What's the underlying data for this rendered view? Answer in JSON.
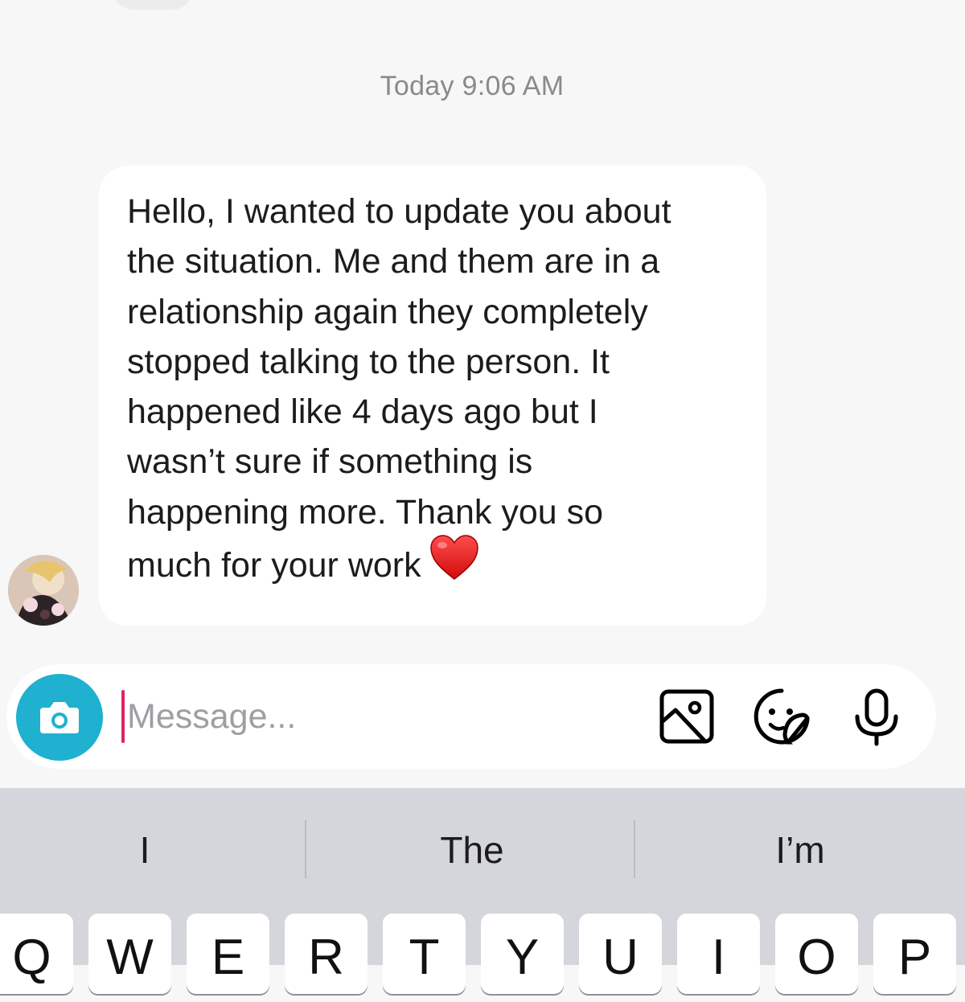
{
  "conversation": {
    "timestamp": "Today 9:06 AM",
    "message": {
      "lines": [
        "Hello, I wanted to update you about",
        "the situation. Me and them are in a",
        "relationship again they completely",
        "stopped talking to the person. It",
        "happened like 4 days ago but I",
        "wasn’t sure if something is",
        "happening more. Thank you so",
        "much for your work"
      ],
      "emoji": "heart-emoji"
    },
    "sender_avatar": "avatar"
  },
  "composer": {
    "placeholder": "Message...",
    "camera_icon": "camera-icon",
    "gallery_icon": "gallery-icon",
    "sticker_icon": "sticker-icon",
    "mic_icon": "microphone-icon",
    "camera_color": "#1fb1cf"
  },
  "keyboard": {
    "suggestions": [
      "I",
      "The",
      "I’m"
    ],
    "top_row": [
      "Q",
      "W",
      "E",
      "R",
      "T",
      "Y",
      "U",
      "I",
      "O",
      "P"
    ]
  }
}
